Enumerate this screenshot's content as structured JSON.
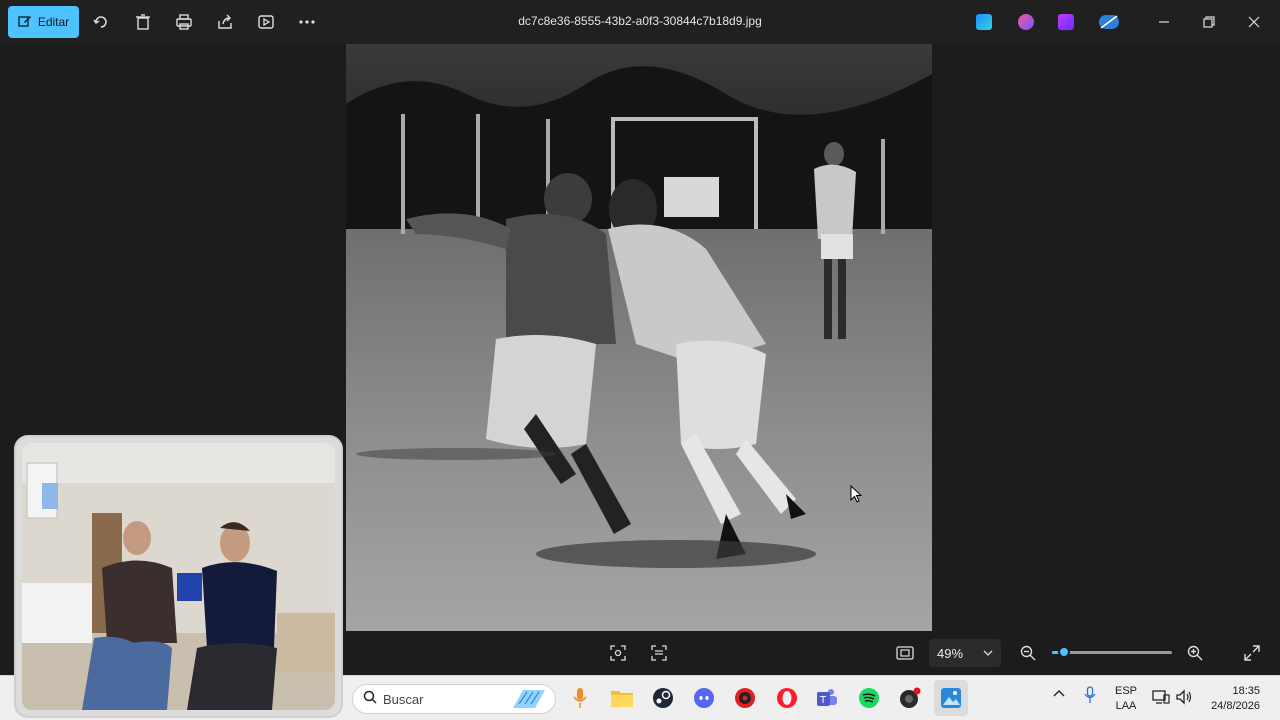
{
  "titlebar": {
    "edit_label": "Editar",
    "filename": "dc7c8e36-8555-43b2-a0f3-30844c7b18d9.jpg",
    "tools": [
      "rotate-icon",
      "delete-icon",
      "print-icon",
      "share-icon",
      "slideshow-icon",
      "more-icon"
    ],
    "app_icons": [
      "designer-icon",
      "copilot-icon",
      "clipchamp-icon",
      "onedrive-icon"
    ]
  },
  "viewer": {
    "zoom_value": "49%",
    "zoom_fraction": 0.1
  },
  "taskbar": {
    "search_placeholder": "Buscar",
    "apps": [
      "microphone-icon",
      "file-explorer-icon",
      "steam-icon",
      "discord-icon",
      "game-app-icon",
      "opera-icon",
      "teams-icon",
      "spotify-icon",
      "recorder-icon",
      "photos-icon"
    ],
    "lang_line1": "ESP",
    "lang_line2": "LAA",
    "time": "18:35",
    "date": "24/8/2026"
  },
  "colors": {
    "accent": "#4cc2ff",
    "background": "#1c1c1c",
    "taskbar": "#efefef"
  }
}
